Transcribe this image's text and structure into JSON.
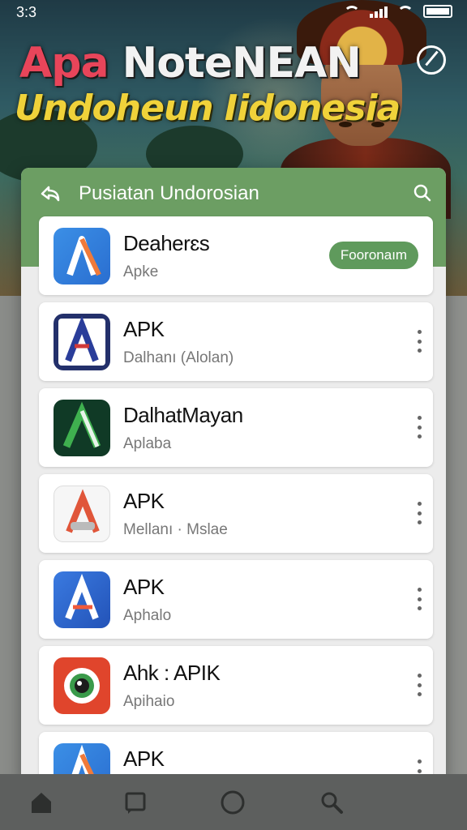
{
  "status_bar": {
    "time": "3:3",
    "icons": [
      "wifi-icon",
      "signal-icon",
      "wifi-icon",
      "battery-icon"
    ]
  },
  "banner": {
    "title_line1_accent": "Apa",
    "title_line1_rest": "NoteNEAN",
    "title_line2": "Undoheun Iidonesia"
  },
  "card": {
    "header_title": "Pusiatan Undorosian",
    "header_color": "#6c9e63",
    "apps": [
      {
        "name": "Deaherɛs",
        "subtitle": "Apke",
        "action": "Fooronaım",
        "icon": "app-a-icon-blue"
      },
      {
        "name": "APK",
        "subtitle": "Dalhanı (Alolan)",
        "icon": "app-a-icon-navy"
      },
      {
        "name": "DalhatMayan",
        "subtitle": "Aplaba",
        "icon": "app-a-icon-green"
      },
      {
        "name": "APK",
        "subtitle": "Mellanı · Mslae",
        "icon": "app-a-icon-white"
      },
      {
        "name": "APK",
        "subtitle": "Aphalo",
        "icon": "app-a-icon-blue"
      },
      {
        "name": "Ahk : APIK",
        "subtitle": "Apihaio",
        "icon": "app-camera-icon"
      },
      {
        "name": "APK",
        "subtitle": "",
        "icon": "app-a-icon-blue"
      }
    ]
  },
  "navbar": {
    "items": [
      "home-icon",
      "square-icon",
      "circle-icon",
      "search-icon"
    ]
  },
  "colors": {
    "accent_green": "#5f9a5c",
    "title_yellow": "#f0d23a",
    "title_red": "#e8455a"
  }
}
